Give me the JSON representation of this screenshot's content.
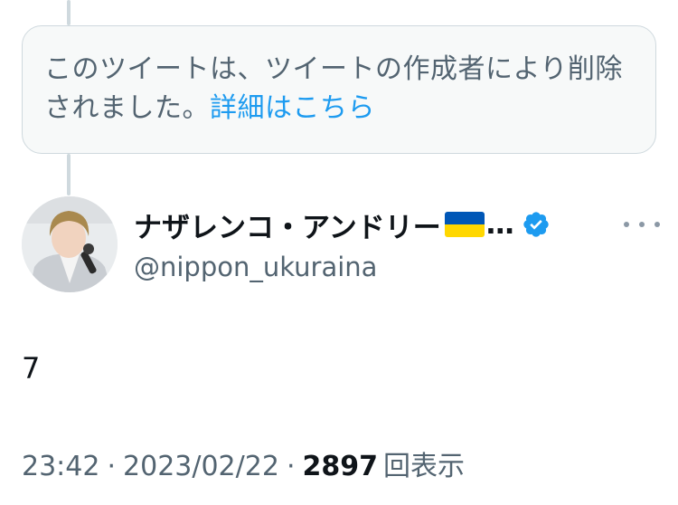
{
  "deleted_notice": {
    "text": "このツイートは、ツイートの作成者により削除されました。",
    "link": "詳細はこちら"
  },
  "user": {
    "display_name": "ナザレンコ・アンドリー",
    "name_overflow": "…",
    "handle": "@nippon_ukuraina",
    "verified_color": "#1d9bf0",
    "flag_colors": [
      "#0057b7",
      "#ffd700"
    ]
  },
  "tweet": {
    "text": "7",
    "time": "23:42",
    "date": "2023/02/22",
    "separator": "·",
    "view_count": "2897",
    "view_label": "回表示"
  }
}
